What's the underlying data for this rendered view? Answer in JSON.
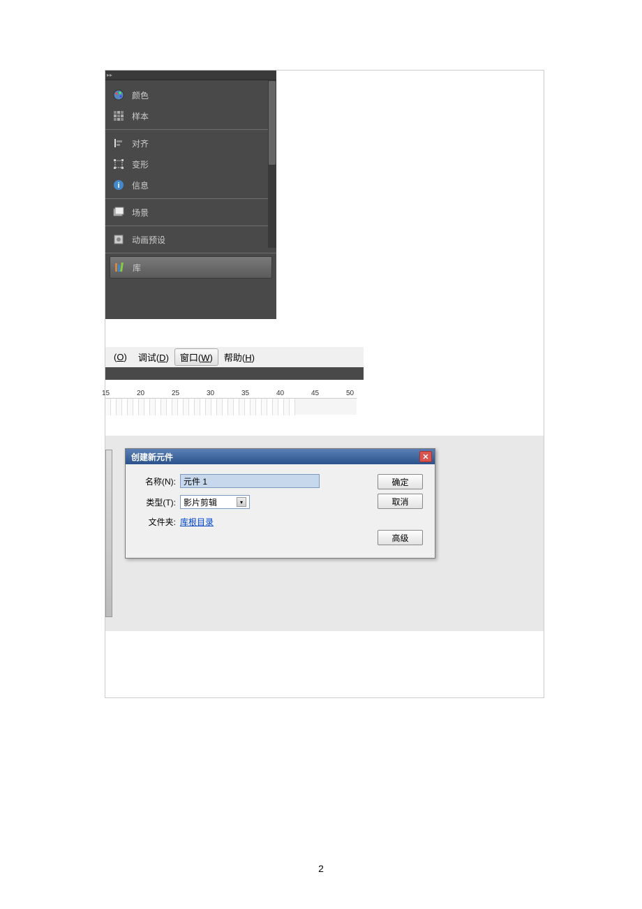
{
  "panel": {
    "items": [
      {
        "label": "颜色",
        "icon": "palette-icon"
      },
      {
        "label": "样本",
        "icon": "swatch-icon"
      },
      {
        "label": "对齐",
        "icon": "align-icon"
      },
      {
        "label": "变形",
        "icon": "transform-icon"
      },
      {
        "label": "信息",
        "icon": "info-icon"
      },
      {
        "label": "场景",
        "icon": "scene-icon"
      },
      {
        "label": "动画预设",
        "icon": "preset-icon"
      },
      {
        "label": "库",
        "icon": "library-icon"
      }
    ]
  },
  "menu": {
    "items": [
      {
        "label": "O",
        "shortcut": "O",
        "full": "(O)"
      },
      {
        "label": "调试",
        "shortcut": "D"
      },
      {
        "label": "窗口",
        "shortcut": "W"
      },
      {
        "label": "帮助",
        "shortcut": "H"
      }
    ]
  },
  "ruler": {
    "start": 15,
    "ticks": [
      15,
      20,
      25,
      30,
      35,
      40,
      45,
      50
    ]
  },
  "dialog": {
    "title": "创建新元件",
    "fields": {
      "name_label": "名称(N):",
      "name_value": "元件 1",
      "type_label": "类型(T):",
      "type_value": "影片剪辑",
      "folder_label": "文件夹:",
      "folder_value": "库根目录"
    },
    "buttons": {
      "ok": "确定",
      "cancel": "取消",
      "advanced": "高级"
    }
  },
  "page_number": "2"
}
